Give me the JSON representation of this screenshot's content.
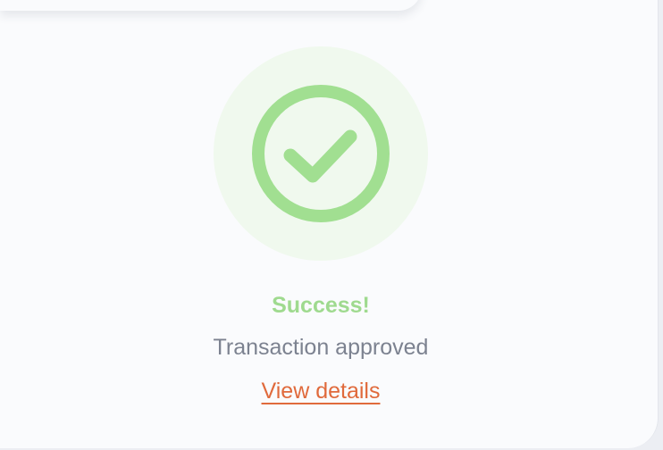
{
  "status": {
    "icon": "check-circle-icon",
    "title": "Success!",
    "message": "Transaction approved",
    "link_label": "View details"
  },
  "colors": {
    "success": "#9fda8f",
    "success_bg": "#f0f9ee",
    "link": "#e06a3c",
    "muted_text": "#7c8290"
  }
}
